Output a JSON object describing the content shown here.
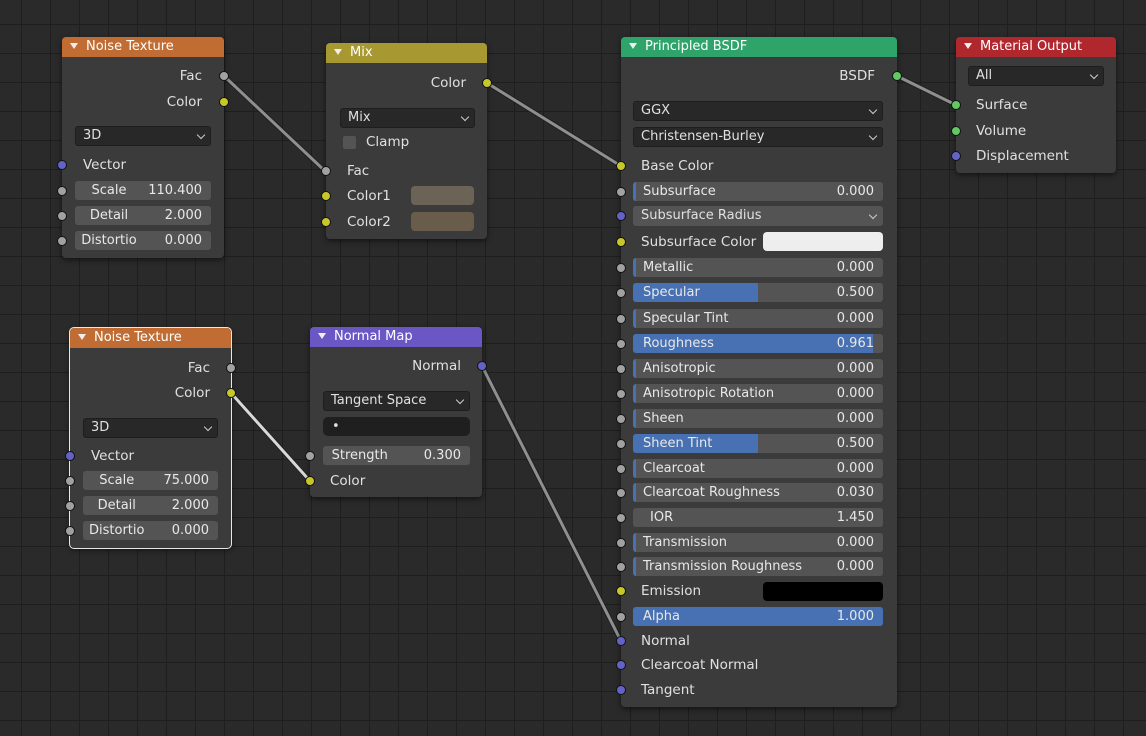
{
  "colors": {
    "texture": "#c16c32",
    "converter": "#a89832",
    "vector": "#6a57c4",
    "shader": "#2ea36a",
    "output": "#b0272d"
  },
  "noise1": {
    "title": "Noise Texture",
    "out_fac": "Fac",
    "out_color": "Color",
    "dim": "3D",
    "vector": "Vector",
    "scale_label": "Scale",
    "scale_value": "110.400",
    "detail_label": "Detail",
    "detail_value": "2.000",
    "distortion_label": "Distortio",
    "distortion_value": "0.000"
  },
  "noise2": {
    "title": "Noise Texture",
    "out_fac": "Fac",
    "out_color": "Color",
    "dim": "3D",
    "vector": "Vector",
    "scale_label": "Scale",
    "scale_value": "75.000",
    "detail_label": "Detail",
    "detail_value": "2.000",
    "distortion_label": "Distortio",
    "distortion_value": "0.000"
  },
  "mix": {
    "title": "Mix",
    "out_color": "Color",
    "mode": "Mix",
    "clamp": "Clamp",
    "fac": "Fac",
    "color1": "Color1",
    "color2": "Color2",
    "color1_swatch": "#6b6356",
    "color2_swatch": "#6a5c4a"
  },
  "normal_map": {
    "title": "Normal Map",
    "out_normal": "Normal",
    "space": "Tangent Space",
    "uv": "•",
    "strength_label": "Strength",
    "strength_value": "0.300",
    "color": "Color"
  },
  "bsdf": {
    "title": "Principled BSDF",
    "out": "BSDF",
    "distribution": "GGX",
    "subsurface_method": "Christensen-Burley",
    "base_color": "Base Color",
    "subsurface_radius": "Subsurface Radius",
    "subsurface_color": "Subsurface Color",
    "emission": "Emission",
    "normal": "Normal",
    "clearcoat_normal": "Clearcoat Normal",
    "tangent": "Tangent",
    "subsurface_color_swatch": "#eeeeee",
    "emission_swatch": "#000000",
    "fields": [
      {
        "label": "Subsurface",
        "value": "0.000",
        "fraction": 0
      },
      {
        "label": "Metallic",
        "value": "0.000",
        "fraction": 0
      },
      {
        "label": "Specular",
        "value": "0.500",
        "fraction": 0.5
      },
      {
        "label": "Specular Tint",
        "value": "0.000",
        "fraction": 0
      },
      {
        "label": "Roughness",
        "value": "0.961",
        "fraction": 0.961
      },
      {
        "label": "Anisotropic",
        "value": "0.000",
        "fraction": 0
      },
      {
        "label": "Anisotropic Rotation",
        "value": "0.000",
        "fraction": 0
      },
      {
        "label": "Sheen",
        "value": "0.000",
        "fraction": 0
      },
      {
        "label": "Sheen Tint",
        "value": "0.500",
        "fraction": 0.5
      },
      {
        "label": "Clearcoat",
        "value": "0.000",
        "fraction": 0
      },
      {
        "label": "Clearcoat Roughness",
        "value": "0.030",
        "fraction": 0.03
      },
      {
        "label": "IOR",
        "value": "1.450",
        "fraction": 0
      },
      {
        "label": "Transmission",
        "value": "0.000",
        "fraction": 0
      },
      {
        "label": "Transmission Roughness",
        "value": "0.000",
        "fraction": 0
      },
      {
        "label": "Alpha",
        "value": "1.000",
        "fraction": 1
      }
    ]
  },
  "output": {
    "title": "Material Output",
    "target": "All",
    "surface": "Surface",
    "volume": "Volume",
    "displacement": "Displacement"
  }
}
